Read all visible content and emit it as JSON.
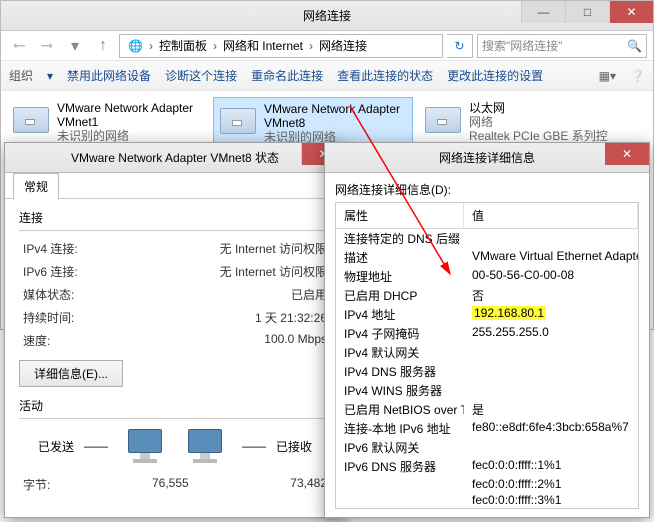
{
  "window": {
    "title": "网络连接",
    "path": [
      "控制面板",
      "网络和 Internet",
      "网络连接"
    ],
    "search_placeholder": "搜索\"网络连接\""
  },
  "toolbar": {
    "org": "组织",
    "items": [
      "禁用此网络设备",
      "诊断这个连接",
      "重命名此连接",
      "查看此连接的状态",
      "更改此连接的设置"
    ]
  },
  "adapters": [
    {
      "name": "VMware Network Adapter VMnet1",
      "sub": "未识别的网络"
    },
    {
      "name": "VMware Network Adapter VMnet8",
      "sub": "未识别的网络"
    },
    {
      "name": "以太网",
      "sub1": "网络",
      "sub2": "Realtek PCIe GBE 系列控制器"
    }
  ],
  "status": {
    "title": "VMware Network Adapter VMnet8 状态",
    "tab": "常规",
    "group1": "连接",
    "rows1": [
      {
        "k": "IPv4 连接:",
        "v": "无 Internet 访问权限"
      },
      {
        "k": "IPv6 连接:",
        "v": "无 Internet 访问权限"
      },
      {
        "k": "媒体状态:",
        "v": "已启用"
      },
      {
        "k": "持续时间:",
        "v": "1 天 21:32:26"
      },
      {
        "k": "速度:",
        "v": "100.0 Mbps"
      }
    ],
    "details_btn": "详细信息(E)...",
    "group2": "活动",
    "sent": "已发送",
    "recv": "已接收",
    "bytes_label": "字节:",
    "sent_val": "76,555",
    "recv_val": "73,482"
  },
  "details": {
    "title": "网络连接详细信息",
    "label": "网络连接详细信息(D):",
    "col1": "属性",
    "col2": "值",
    "rows": [
      {
        "k": "连接特定的 DNS 后缀",
        "v": ""
      },
      {
        "k": "描述",
        "v": "VMware Virtual Ethernet Adapter for VM"
      },
      {
        "k": "物理地址",
        "v": "00-50-56-C0-00-08"
      },
      {
        "k": "已启用 DHCP",
        "v": "否"
      },
      {
        "k": "IPv4 地址",
        "v": "192.168.80.1",
        "hl": true
      },
      {
        "k": "IPv4 子网掩码",
        "v": "255.255.255.0"
      },
      {
        "k": "IPv4 默认网关",
        "v": ""
      },
      {
        "k": "IPv4 DNS 服务器",
        "v": ""
      },
      {
        "k": "IPv4 WINS 服务器",
        "v": ""
      },
      {
        "k": "已启用 NetBIOS over Tc...",
        "v": "是"
      },
      {
        "k": "连接-本地 IPv6 地址",
        "v": "fe80::e8df:6fe4:3bcb:658a%7"
      },
      {
        "k": "IPv6 默认网关",
        "v": ""
      },
      {
        "k": "IPv6 DNS 服务器",
        "v": "fec0:0:0:ffff::1%1"
      },
      {
        "k": "",
        "v": "fec0:0:0:ffff::2%1"
      },
      {
        "k": "",
        "v": "fec0:0:0:ffff::3%1"
      }
    ]
  }
}
